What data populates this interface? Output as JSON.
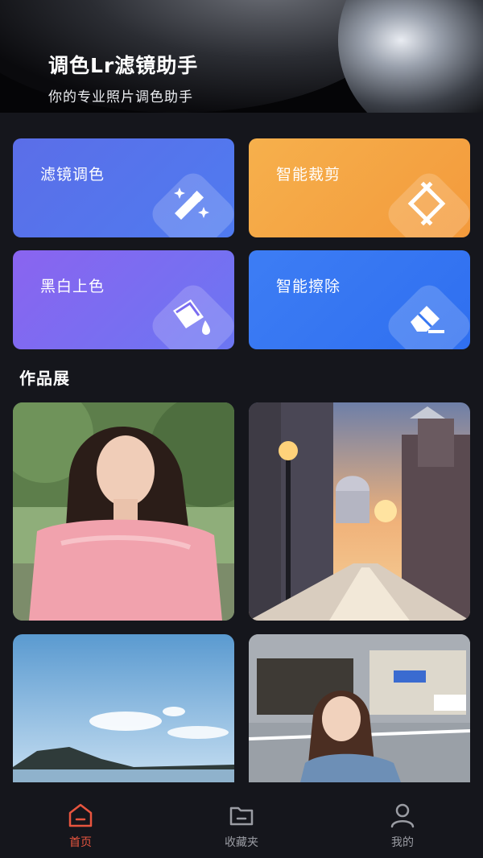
{
  "header": {
    "title": "调色Lr滤镜助手",
    "subtitle": "你的专业照片调色助手"
  },
  "features": [
    {
      "label": "滤镜调色",
      "icon": "magic-wand-icon"
    },
    {
      "label": "智能裁剪",
      "icon": "crop-icon"
    },
    {
      "label": "黑白上色",
      "icon": "paint-bucket-icon"
    },
    {
      "label": "智能擦除",
      "icon": "eraser-icon"
    }
  ],
  "gallery": {
    "title": "作品展"
  },
  "tabbar": {
    "tabs": [
      {
        "label": "首页",
        "icon": "home-icon",
        "active": true
      },
      {
        "label": "收藏夹",
        "icon": "folder-icon",
        "active": false
      },
      {
        "label": "我的",
        "icon": "user-icon",
        "active": false
      }
    ]
  },
  "colors": {
    "active_tab": "#e8553f",
    "inactive_tab": "#9a9ca3",
    "background": "#15161c"
  }
}
